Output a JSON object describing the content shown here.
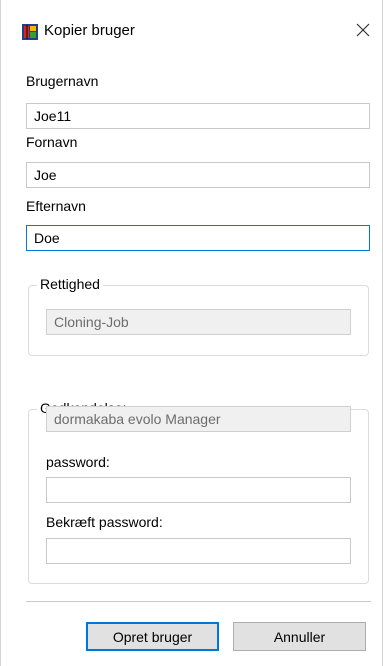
{
  "window": {
    "title": "Kopier bruger",
    "icon": "app-icon",
    "close_icon": "close-icon"
  },
  "fields": {
    "username_label": "Brugernavn",
    "username_value": "Joe11",
    "firstname_label": "Fornavn",
    "firstname_value": "Joe",
    "lastname_label": "Efternavn",
    "lastname_value": "Doe"
  },
  "rights_group": {
    "legend": "Rettighed",
    "value": "Cloning-Job"
  },
  "auth_group": {
    "legend": "Godkendelse:",
    "value": "dormakaba evolo Manager",
    "password_label": "password:",
    "password_value": "",
    "confirm_label": "Bekræft password:",
    "confirm_value": ""
  },
  "buttons": {
    "create_label": "Opret bruger",
    "cancel_label": "Annuller"
  },
  "colors": {
    "focus_border": "#0078d7",
    "button_bg": "#e1e1e1",
    "readonly_bg": "#f0f0f0"
  }
}
